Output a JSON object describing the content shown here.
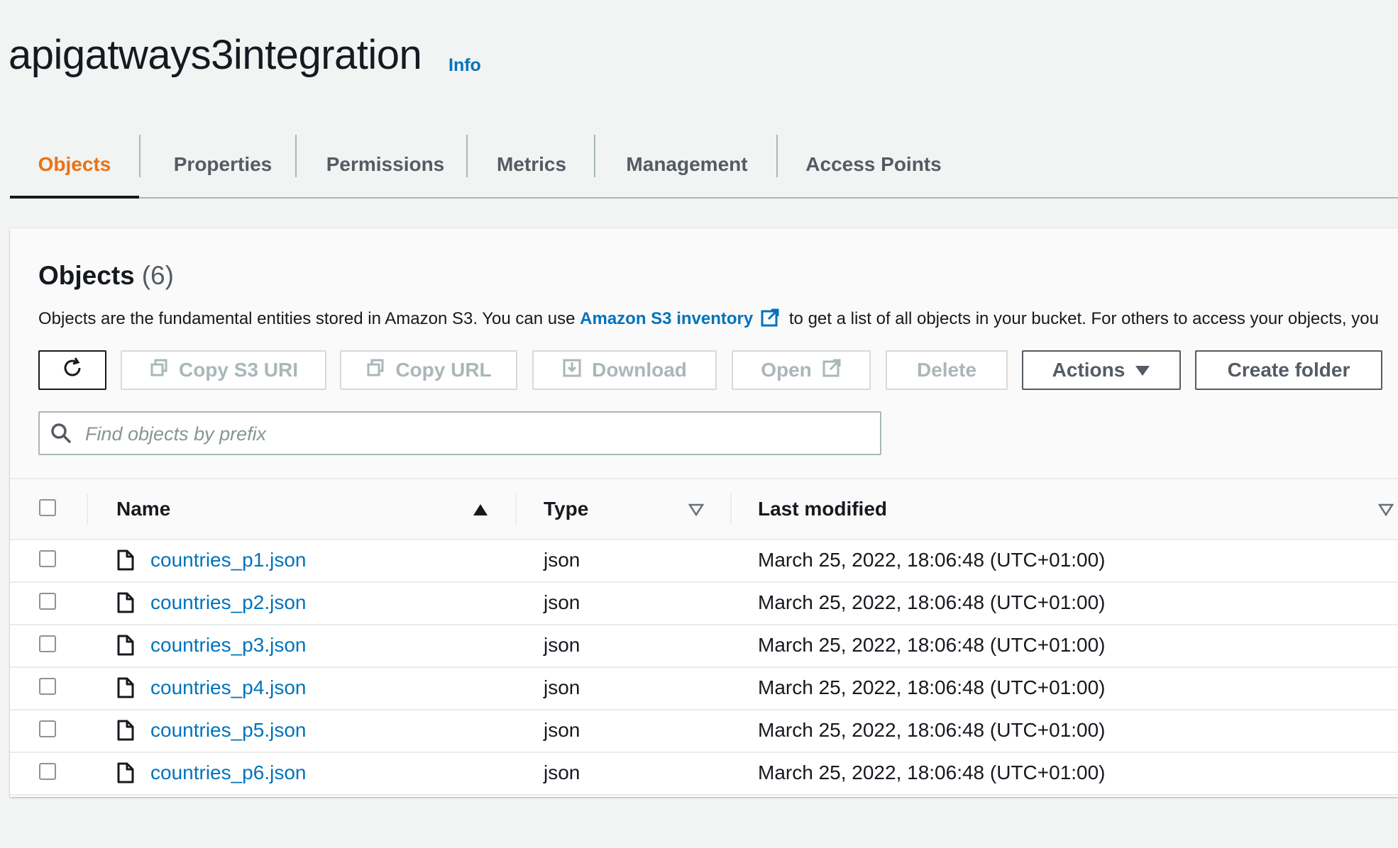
{
  "bucket": {
    "name": "apigatways3integration",
    "info_label": "Info"
  },
  "tabs": [
    {
      "label": "Objects",
      "active": true
    },
    {
      "label": "Properties",
      "active": false
    },
    {
      "label": "Permissions",
      "active": false
    },
    {
      "label": "Metrics",
      "active": false
    },
    {
      "label": "Management",
      "active": false
    },
    {
      "label": "Access Points",
      "active": false
    }
  ],
  "objects_panel": {
    "title": "Objects",
    "count": "(6)",
    "description_prefix": "Objects are the fundamental entities stored in Amazon S3. You can use ",
    "description_link": "Amazon S3 inventory",
    "description_suffix": " to get a list of all objects in your bucket. For others to access your objects, you"
  },
  "toolbar": {
    "refresh_icon": "refresh-icon",
    "copy_s3_uri": "Copy S3 URI",
    "copy_url": "Copy URL",
    "download": "Download",
    "open": "Open",
    "delete": "Delete",
    "actions": "Actions",
    "create_folder": "Create folder"
  },
  "search": {
    "placeholder": "Find objects by prefix",
    "value": ""
  },
  "table": {
    "columns": {
      "name": "Name",
      "type": "Type",
      "last_modified": "Last modified"
    },
    "sort": {
      "column": "Name",
      "direction": "ascending"
    },
    "rows": [
      {
        "name": "countries_p1.json",
        "type": "json",
        "last_modified": "March 25, 2022, 18:06:48 (UTC+01:00)"
      },
      {
        "name": "countries_p2.json",
        "type": "json",
        "last_modified": "March 25, 2022, 18:06:48 (UTC+01:00)"
      },
      {
        "name": "countries_p3.json",
        "type": "json",
        "last_modified": "March 25, 2022, 18:06:48 (UTC+01:00)"
      },
      {
        "name": "countries_p4.json",
        "type": "json",
        "last_modified": "March 25, 2022, 18:06:48 (UTC+01:00)"
      },
      {
        "name": "countries_p5.json",
        "type": "json",
        "last_modified": "March 25, 2022, 18:06:48 (UTC+01:00)"
      },
      {
        "name": "countries_p6.json",
        "type": "json",
        "last_modified": "March 25, 2022, 18:06:48 (UTC+01:00)"
      }
    ]
  },
  "colors": {
    "link": "#0073bb",
    "active_tab": "#ec7211",
    "text": "#16191f",
    "disabled": "#aab7b8"
  }
}
